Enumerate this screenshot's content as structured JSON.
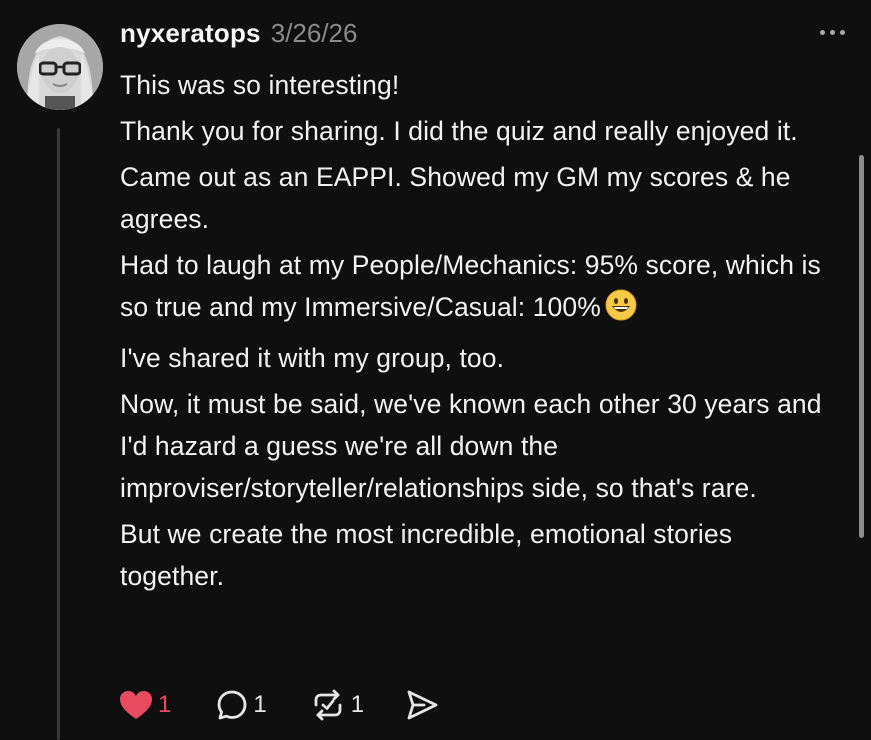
{
  "post": {
    "author": "nyxeratops",
    "date": "3/26/26",
    "paragraphs": [
      "This was so interesting!",
      "Thank you for sharing. I did the quiz and really enjoyed it.",
      "Came out as an EAPPI. Showed my GM my scores & he agrees.",
      "Had to laugh at my People/Mechanics: 95% score, which is so true and my Immersive/Casual: 100%",
      "I've shared it with my group, too.",
      "Now, it must be said, we've known each other 30 years and I'd hazard a guess we're all down the improviser/storyteller/relationships side, so that's rare.",
      "But we create the most  incredible, emotional stories together."
    ],
    "emoji": "grinning-face"
  },
  "actions": {
    "likes": "1",
    "replies": "1",
    "reposts": "1",
    "like_color": "#e84a5f"
  },
  "icons": [
    "more-icon",
    "heart-icon",
    "comment-icon",
    "repost-icon",
    "share-icon",
    "grinning-face-emoji"
  ]
}
